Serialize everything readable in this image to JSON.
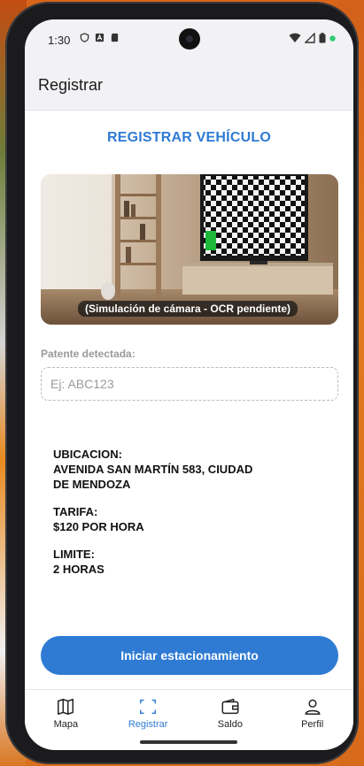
{
  "status_bar": {
    "time": "1:30",
    "icons_left": [
      "shield-icon",
      "a-icon",
      "sd-card-icon"
    ],
    "icons_right": [
      "wifi-icon",
      "signal-icon",
      "battery-icon",
      "dot-indicator-icon"
    ]
  },
  "app_bar": {
    "title": "Registrar"
  },
  "page": {
    "heading": "REGISTRAR VEHÍCULO",
    "camera_caption": "(Simulación de cámara - OCR pendiente)",
    "plate_label": "Patente detectada:",
    "plate_placeholder": "Ej: ABC123",
    "plate_value": ""
  },
  "info": {
    "location_label": "UBICACION:",
    "location_value": "AVENIDA SAN MARTÍN 583, CIUDAD DE MENDOZA",
    "rate_label": "TARIFA:",
    "rate_value": "$120 POR HORA",
    "limit_label": "LIMITE:",
    "limit_value": "2 HORAS"
  },
  "cta": {
    "label": "Iniciar estacionamiento"
  },
  "nav": {
    "items": [
      {
        "label": "Mapa",
        "icon": "map-icon",
        "active": false
      },
      {
        "label": "Registrar",
        "icon": "scan-icon",
        "active": true
      },
      {
        "label": "Saldo",
        "icon": "wallet-icon",
        "active": false
      },
      {
        "label": "Perfil",
        "icon": "person-icon",
        "active": false
      }
    ]
  },
  "colors": {
    "accent": "#2f7bd4",
    "muted_text": "#9a9a9a",
    "app_bar_bg": "#f2f2f5",
    "status_dot": "#2ecc71"
  }
}
